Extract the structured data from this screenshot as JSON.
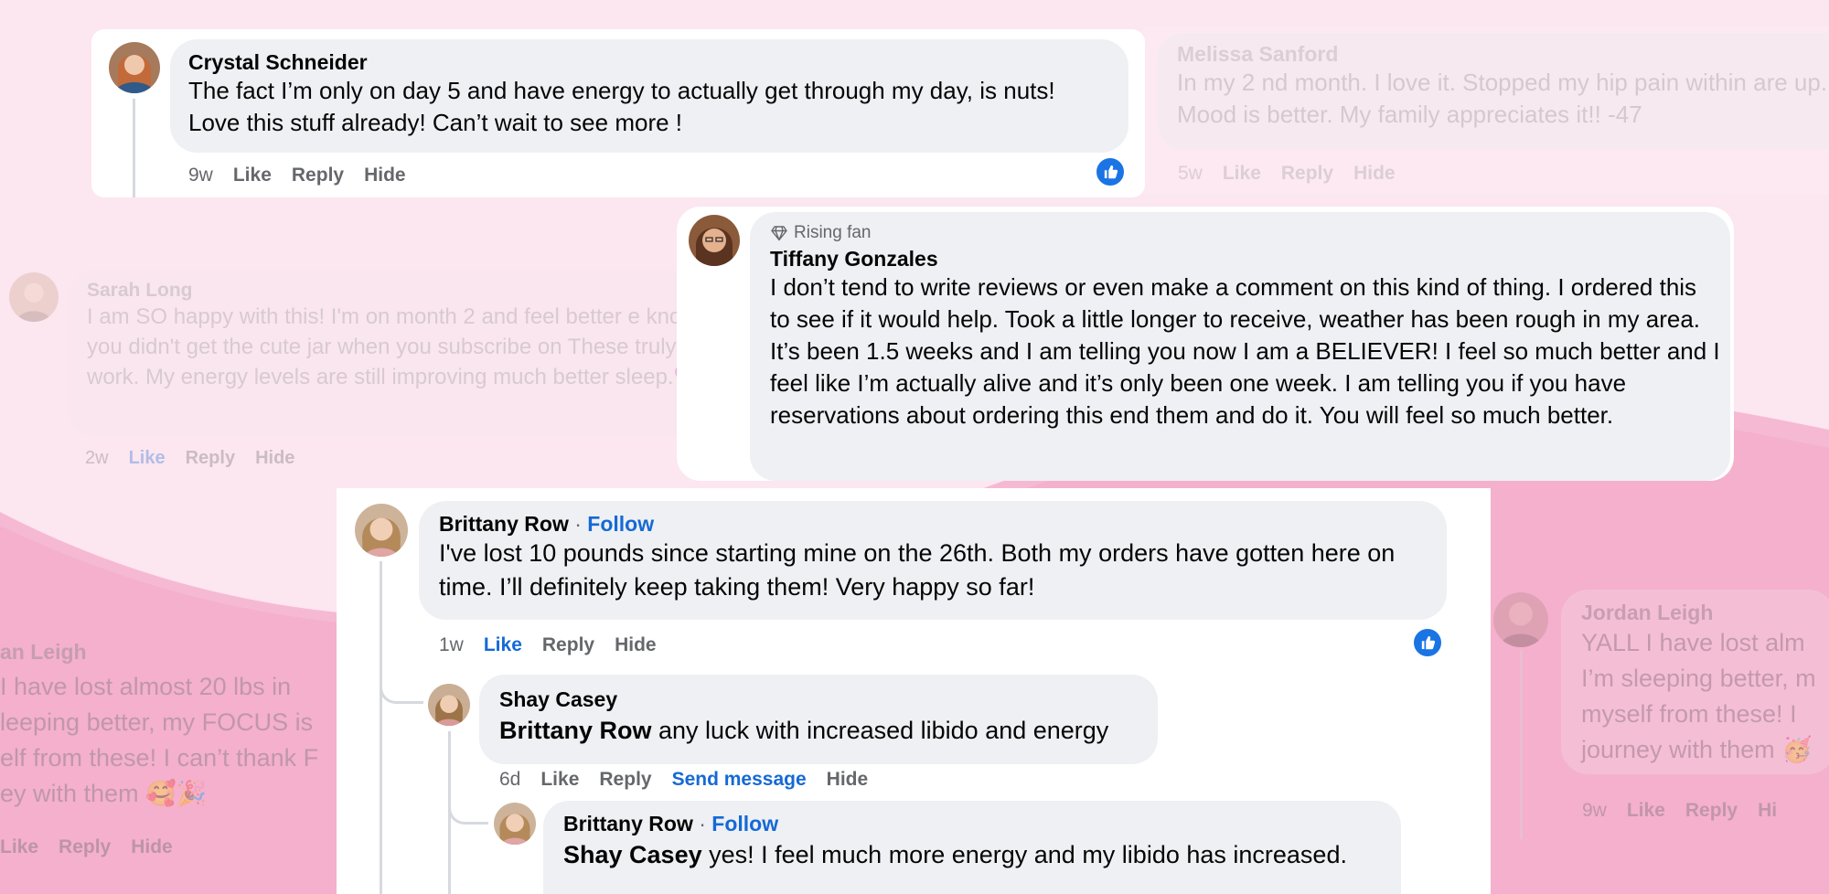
{
  "colors": {
    "background": "#fbe3ee",
    "background_wave": "#f6b9d3",
    "bubble": "#eef0f3",
    "link_blue": "#1569d6",
    "like_badge": "#1b74e4",
    "meta_gray": "#65676b"
  },
  "comments": {
    "crystal": {
      "name": "Crystal Schneider",
      "text": "The fact I’m only on day 5 and have energy to actually get through my day, is nuts! Love this stuff already! Can’t wait to see more !",
      "time": "9w",
      "like": "Like",
      "reply": "Reply",
      "hide": "Hide",
      "reaction_icon": "like-icon"
    },
    "melissa": {
      "name": "Melissa Sanford",
      "text": "In my 2 nd month. I love it. Stopped my hip pain within are up. Mood is better. My family appreciates it!! -47",
      "time": "5w",
      "like": "Like",
      "reply": "Reply",
      "hide": "Hide"
    },
    "sarah": {
      "name": "Sarah Long",
      "text": "I am SO happy with this! I'm on month 2 and feel better e known you didn't get the cute jar when you subscribe on These truly do work. My energy levels are still improving much better sleep.💜",
      "time": "2w",
      "like": "Like",
      "reply": "Reply",
      "hide": "Hide"
    },
    "tiffany": {
      "badge": "Rising fan",
      "badge_icon": "diamond-icon",
      "name": "Tiffany Gonzales",
      "text": "I don’t tend to write reviews or even make a comment on this kind of thing. I ordered this to see if it would help. Took a little longer to receive, weather has been rough in my area. It’s been 1.5 weeks and I am telling you now I am a BELIEVER! I feel so much better and I feel like I’m actually alive and it’s only been one week. I am telling you if you have reservations about ordering this end them and do it. You will feel so much better."
    },
    "left_faded": {
      "name": "an Leigh",
      "text": " I have lost almost 20 lbs in leeping better, my FOCUS is elf from these! I can’t thank F ey with them 🥰🎉",
      "like": "Like",
      "reply": "Reply",
      "hide": "Hide"
    },
    "jordan": {
      "name": "Jordan Leigh",
      "text": "YALL I have lost alm I’m sleeping better, m myself from these! I journey with them 🥳",
      "time": "9w",
      "like": "Like",
      "reply": "Reply",
      "hide": "Hi"
    },
    "brittany": {
      "name": "Brittany Row",
      "separator": "·",
      "follow": "Follow",
      "text": "I've lost 10 pounds since starting mine on the 26th. Both my orders have gotten here on time. I’ll definitely keep taking them! Very happy so far!",
      "time": "1w",
      "like": "Like",
      "reply": "Reply",
      "hide": "Hide",
      "reaction_icon": "like-icon"
    },
    "shay": {
      "name": "Shay Casey",
      "mention": "Brittany Row",
      "text": " any luck with increased libido and energy",
      "time": "6d",
      "like": "Like",
      "reply": "Reply",
      "send_message": "Send message",
      "hide": "Hide"
    },
    "brittany_reply": {
      "name": "Brittany Row",
      "separator": "·",
      "follow": "Follow",
      "mention": "Shay Casey",
      "text": " yes! I feel much more energy and my libido has increased."
    }
  }
}
